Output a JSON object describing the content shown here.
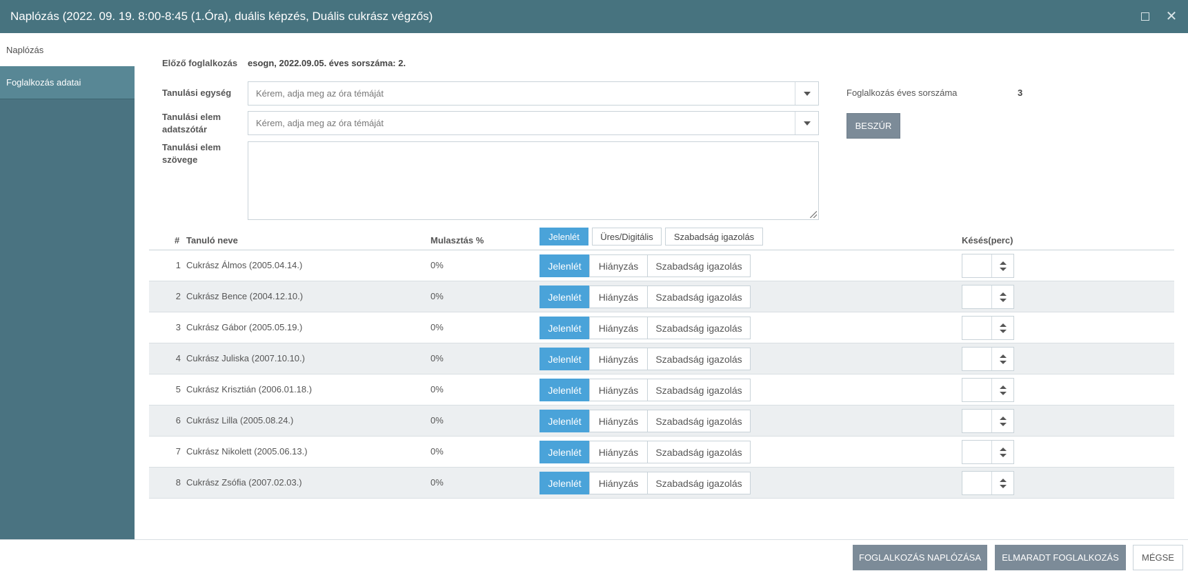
{
  "window": {
    "title": "Naplózás (2022. 09. 19. 8:00-8:45 (1.Óra), duális képzés, Duális cukrász végzős)",
    "close_glyph": "✕"
  },
  "sidebar": {
    "items": [
      {
        "label": "Naplózás"
      },
      {
        "label": "Foglalkozás adatai"
      }
    ]
  },
  "form": {
    "previous_label": "Előző foglalkozás",
    "previous_value": "esogn, 2022.09.05. éves sorszáma: 2.",
    "unit_label": "Tanulási egység",
    "unit_placeholder": "Kérem, adja meg az óra témáját",
    "dict_label": "Tanulási elem adatszótár",
    "dict_placeholder": "Kérem, adja meg az óra témáját",
    "text_label": "Tanulási elem szövege",
    "text_value": "",
    "annual_label": "Foglalkozás éves sorszáma",
    "annual_value": "3",
    "insert_button": "BESZÚR"
  },
  "table": {
    "headers": {
      "num": "#",
      "name": "Tanuló neve",
      "absence": "Mulasztás %",
      "late": "Késés(perc)"
    },
    "bulk_options": [
      "Jelenlét",
      "Üres/Digitális",
      "Szabadság igazolás"
    ],
    "row_options": [
      "Jelenlét",
      "Hiányzás",
      "Szabadság igazolás"
    ],
    "rows": [
      {
        "num": "1",
        "name": "Cukrász Álmos (2005.04.14.)",
        "pct": "0%",
        "late": ""
      },
      {
        "num": "2",
        "name": "Cukrász Bence (2004.12.10.)",
        "pct": "0%",
        "late": ""
      },
      {
        "num": "3",
        "name": "Cukrász Gábor (2005.05.19.)",
        "pct": "0%",
        "late": ""
      },
      {
        "num": "4",
        "name": "Cukrász Juliska (2007.10.10.)",
        "pct": "0%",
        "late": ""
      },
      {
        "num": "5",
        "name": "Cukrász Krisztián (2006.01.18.)",
        "pct": "0%",
        "late": ""
      },
      {
        "num": "6",
        "name": "Cukrász Lilla (2005.08.24.)",
        "pct": "0%",
        "late": ""
      },
      {
        "num": "7",
        "name": "Cukrász Nikolett (2005.06.13.)",
        "pct": "0%",
        "late": ""
      },
      {
        "num": "8",
        "name": "Cukrász Zsófia (2007.02.03.)",
        "pct": "0%",
        "late": ""
      }
    ]
  },
  "footer": {
    "log_button": "FOGLALKOZÁS NAPLÓZÁSA",
    "missed_button": "ELMARADT FOGLALKOZÁS",
    "cancel_button": "MÉGSE"
  }
}
